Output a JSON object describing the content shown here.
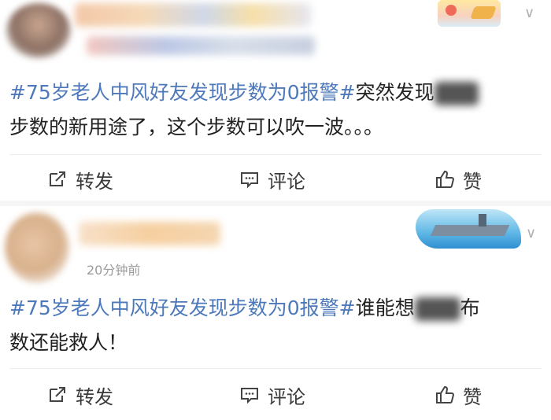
{
  "feed": {
    "posts": [
      {
        "hashtag": "#75岁老人中风好友发现步数为0报警#",
        "text_line1_after": "突然发现",
        "text_line2": "步数的新用途了，这个步数可以吹一波。。。",
        "actions": {
          "forward": "转发",
          "comment": "评论",
          "like": "赞"
        }
      },
      {
        "time": "20分钟前",
        "hashtag": "#75岁老人中风好友发现步数为0报警#",
        "text_line1_after": "谁能想",
        "text_line1_tail": "布",
        "text_line2": "数还能救人！",
        "actions": {
          "forward": "转发",
          "comment": "评论",
          "like": "赞"
        }
      }
    ]
  },
  "icons": {
    "forward": "share-arrow-icon",
    "comment": "comment-bubble-icon",
    "like": "thumbs-up-icon",
    "expand": "chevron-down-icon"
  },
  "colors": {
    "hashtag": "#4d79ba",
    "meta": "#9a9a9a",
    "text": "#222222"
  }
}
